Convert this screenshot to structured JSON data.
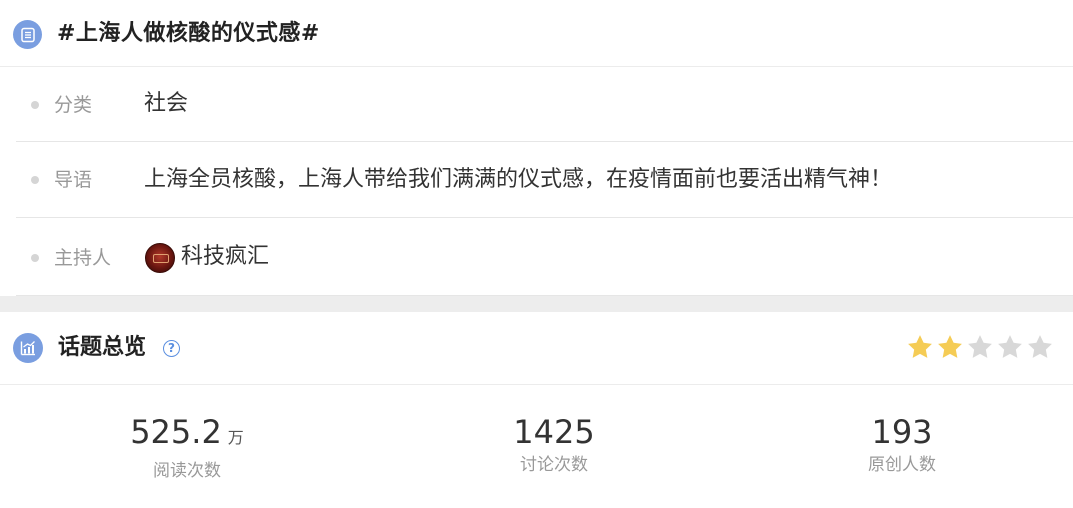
{
  "topic": {
    "title": "#上海人做核酸的仪式感#"
  },
  "info": {
    "category_label": "分类",
    "category_value": "社会",
    "intro_label": "导语",
    "intro_value": "上海全员核酸，上海人带给我们满满的仪式感，在疫情面前也要活出精气神！",
    "host_label": "主持人",
    "host_name": "科技疯汇"
  },
  "overview": {
    "title": "话题总览",
    "help_symbol": "?",
    "rating": {
      "filled": 2,
      "total": 5
    },
    "star_color_filled": "#f5cc55",
    "star_color_empty": "#d8d8d8"
  },
  "stats": {
    "read_count": "525.2",
    "read_unit": "万",
    "read_label": "阅读次数",
    "discuss_count": "1425",
    "discuss_label": "讨论次数",
    "original_count": "193",
    "original_label": "原创人数"
  },
  "icons": {
    "topic": "list-icon",
    "overview": "chart-icon",
    "help": "question-icon",
    "dot": "bullet-dot-icon"
  },
  "colors": {
    "accent": "#7a9ee0",
    "link": "#5b8fe0"
  }
}
